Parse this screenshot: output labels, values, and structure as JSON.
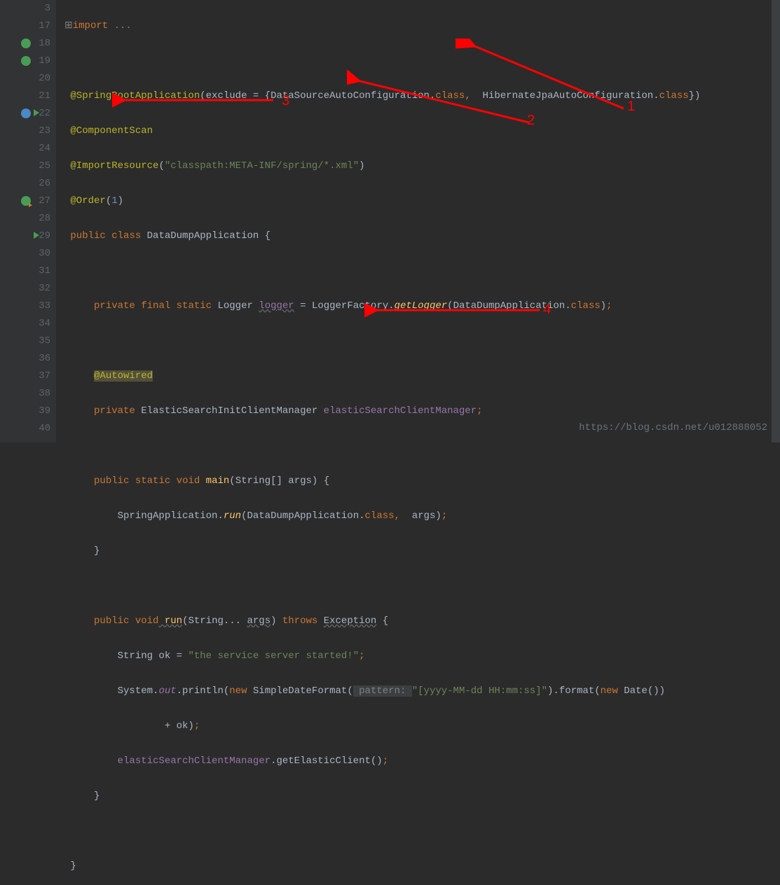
{
  "watermark": "https://blog.csdn.net/u012888052",
  "lines": {
    "start": 3,
    "numbers": [
      3,
      17,
      18,
      19,
      20,
      21,
      22,
      23,
      24,
      25,
      26,
      27,
      28,
      29,
      30,
      31,
      32,
      33,
      34,
      35,
      36,
      37,
      38,
      39,
      40
    ]
  },
  "arrows": {
    "a1": "1",
    "a2": "2",
    "a3": "3",
    "a4": "4"
  },
  "code": {
    "l3_import": "import",
    "l3_dots": "...",
    "l18_ann": "@SpringBootApplication",
    "l18_p1": "(",
    "l18_exclude": "exclude",
    "l18_eq": " = {",
    "l18_dsac": "DataSourceAutoConfiguration.",
    "l18_class1": "class",
    "l18_comma": ", ",
    "l18_hib": " HibernateJpaAutoConfiguration.",
    "l18_class2": "class",
    "l18_p2": "})",
    "l19_ann": "@ComponentScan",
    "l20_ann": "@ImportResource",
    "l20_p1": "(",
    "l20_str": "\"classpath:META-INF/spring/*.xml\"",
    "l20_p2": ")",
    "l21_ann": "@Order",
    "l21_p1": "(",
    "l21_num": "1",
    "l21_p2": ")",
    "l22_public": "public",
    "l22_class": "class",
    "l22_name": " DataDumpApplication {",
    "l24_private": "private",
    "l24_final": "final",
    "l24_static": "static",
    "l24_logger_t": " Logger ",
    "l24_logger_v": "logger",
    "l24_eq": " = LoggerFactory.",
    "l24_getlog": "getLogger",
    "l24_p1": "(DataDumpApplication.",
    "l24_class": "class",
    "l24_p2": ")",
    "l24_semi": ";",
    "l26_ann": "@Autowired",
    "l27_private": "private",
    "l27_type": " ElasticSearchInitClientManager ",
    "l27_field": "elasticSearchClientManager",
    "l27_semi": ";",
    "l29_public": "public",
    "l29_static": "static",
    "l29_void": "void",
    "l29_main": " main",
    "l29_args": "(String[] args) {",
    "l30_sa": "SpringApplication.",
    "l30_run": "run",
    "l30_p1": "(DataDumpApplication.",
    "l30_class": "class",
    "l30_comma": ", ",
    "l30_args": " args)",
    "l30_semi": ";",
    "l31_brace": "}",
    "l33_public": "public",
    "l33_void": "void",
    "l33_run": " run",
    "l33_p1": "(String... ",
    "l33_args": "args",
    "l33_p2": ")",
    "l33_throws": " throws ",
    "l33_exc": "Exception",
    "l33_brace": " {",
    "l34_str_t": "String ok = ",
    "l34_str_v": "\"the service server started!\"",
    "l34_semi": ";",
    "l35_sys": "System.",
    "l35_out": "out",
    "l35_println": ".println(",
    "l35_new": "new",
    "l35_sdf": " SimpleDateFormat(",
    "l35_pattern": " pattern: ",
    "l35_fmt": "\"[yyyy-MM-dd HH:mm:ss]\"",
    "l35_fmt2": ").format(",
    "l35_new2": "new",
    "l35_date": " Date())",
    "l36_plus": "+ ok)",
    "l36_semi": ";",
    "l37_field": "elasticSearchClientManager",
    "l37_call": ".getElasticClient()",
    "l37_semi": ";",
    "l38_brace": "}",
    "l40_brace": "}"
  }
}
